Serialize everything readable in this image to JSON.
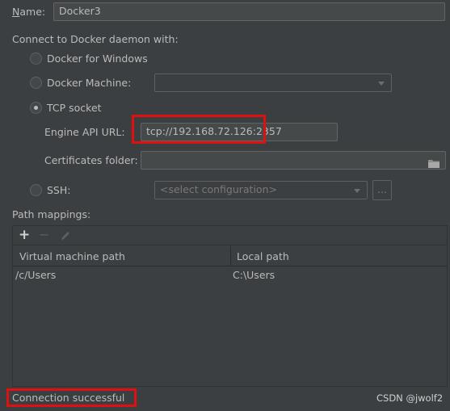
{
  "name_field": {
    "label": "Name:",
    "value": "Docker3"
  },
  "connect_label": "Connect to Docker daemon with:",
  "options": {
    "docker_for_windows": "Docker for Windows",
    "docker_machine": "Docker Machine:",
    "tcp_socket": "TCP socket",
    "ssh": "SSH:"
  },
  "docker_machine_value": "",
  "engine_api": {
    "label": "Engine API URL:",
    "value": "tcp://192.168.72.126:2357"
  },
  "certificates": {
    "label": "Certificates folder:",
    "value": ""
  },
  "ssh_select": {
    "placeholder": "<select configuration>"
  },
  "ssh_browse": "...",
  "path_mappings": {
    "label": "Path mappings:",
    "toolbar": {
      "add": "+",
      "remove": "−"
    },
    "columns": [
      "Virtual machine path",
      "Local path"
    ],
    "rows": [
      {
        "vm_path": "/c/Users",
        "local_path": "C:\\Users"
      }
    ]
  },
  "status": "Connection successful",
  "watermark": "CSDN @jwolf2",
  "colors": {
    "background": "#3c3f41",
    "text": "#bbbbbb",
    "highlight": "#e01010",
    "field": "#45494a"
  }
}
